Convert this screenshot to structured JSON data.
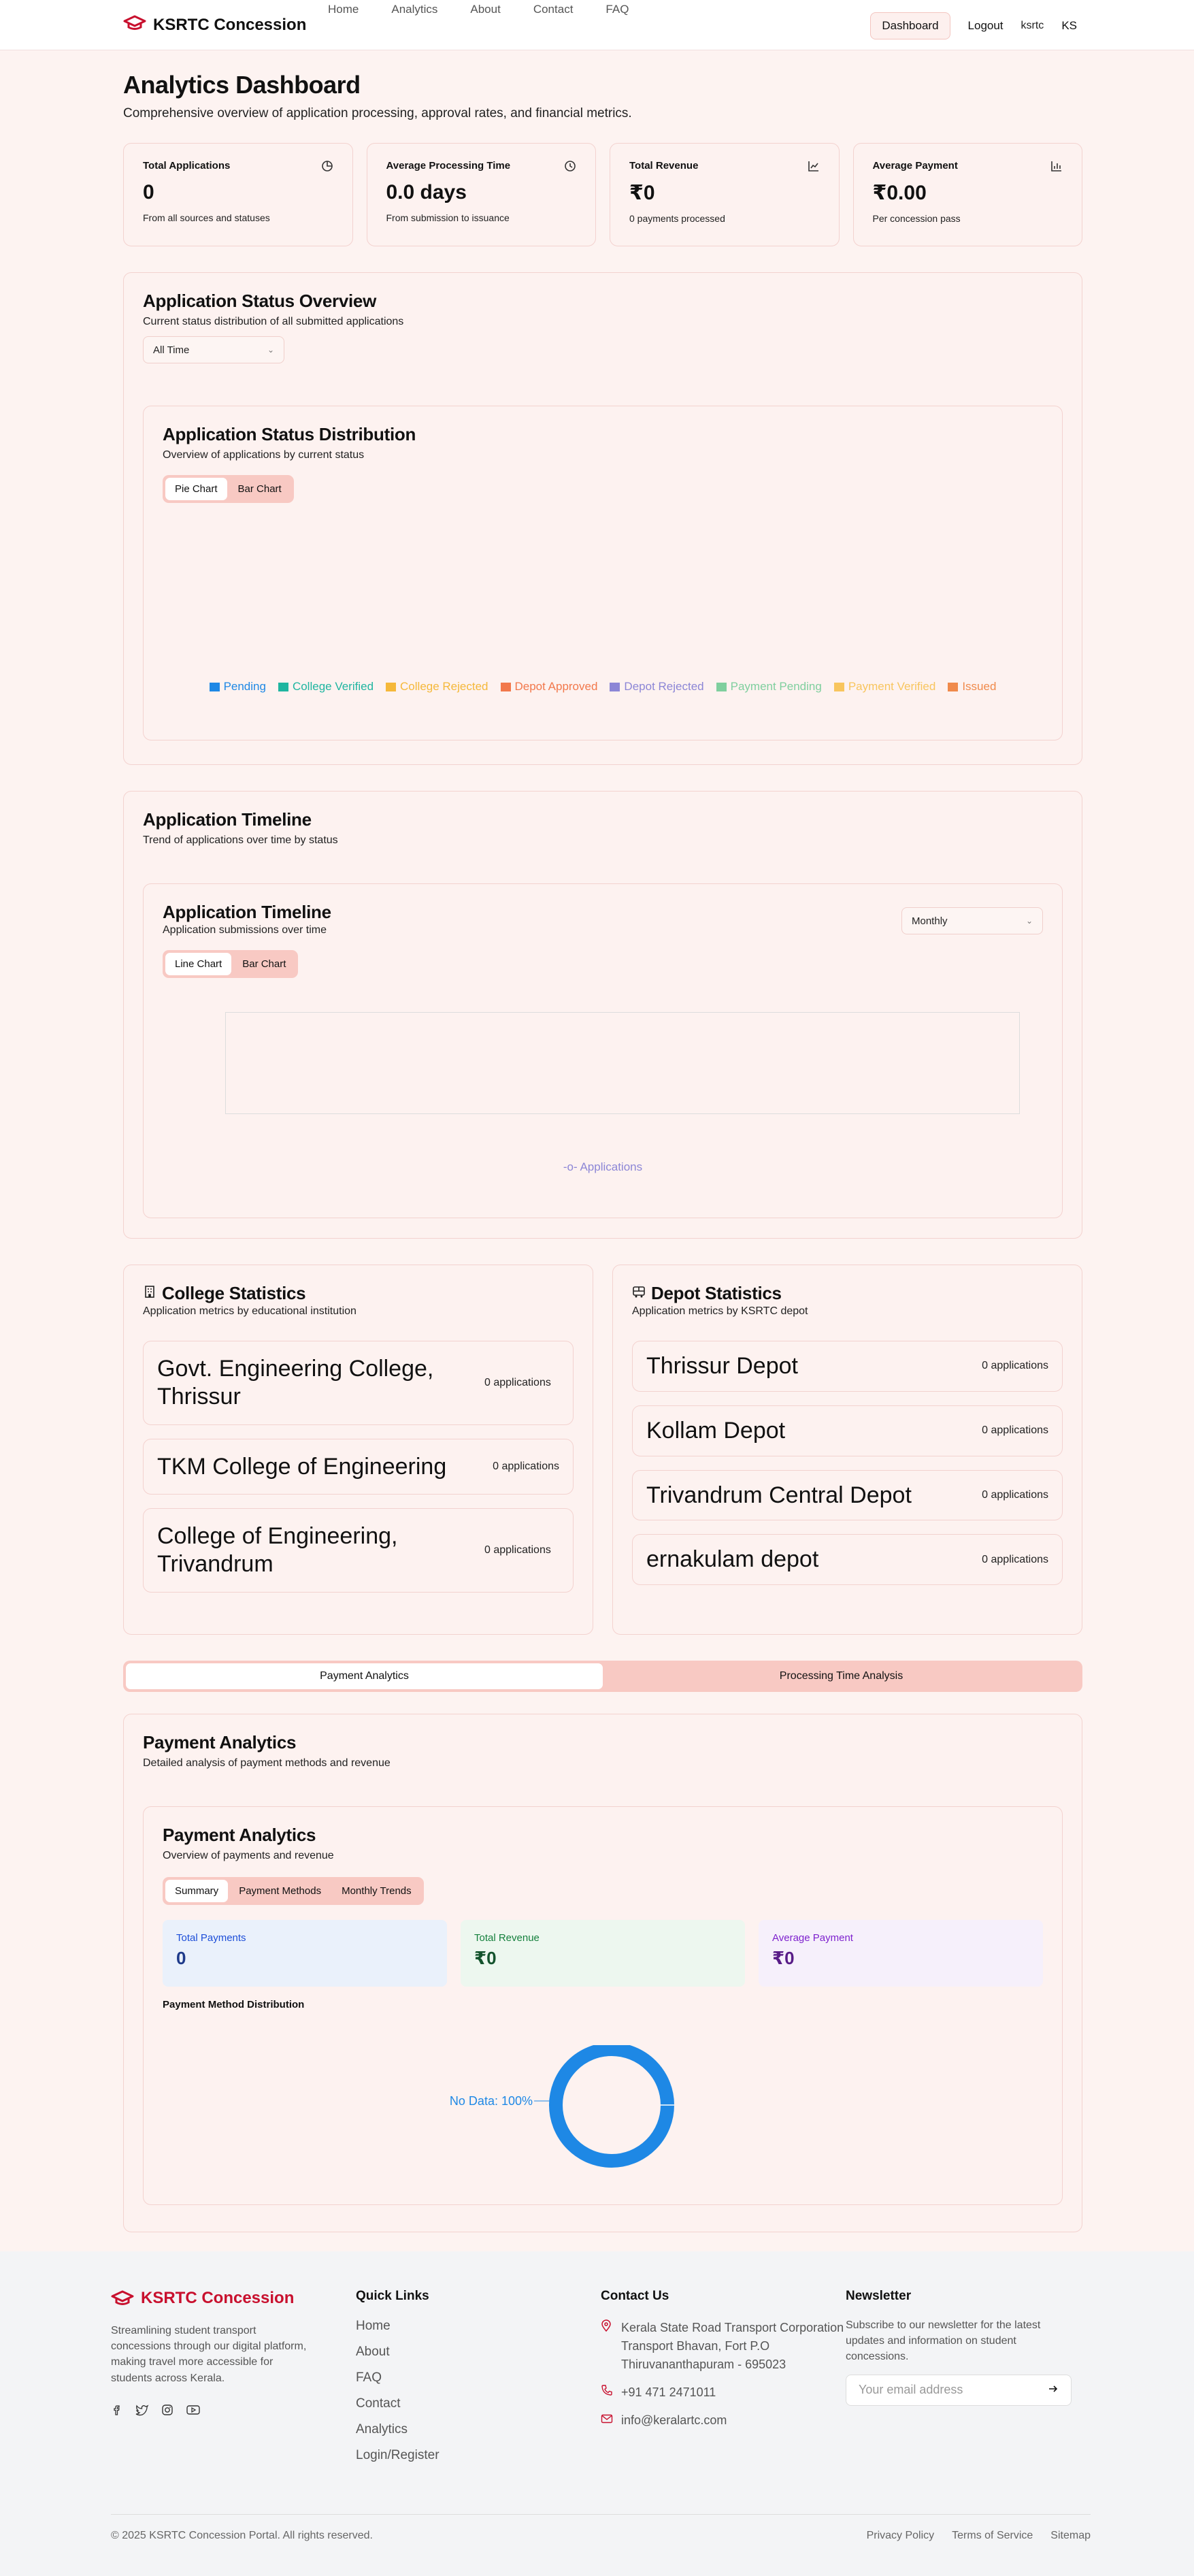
{
  "nav": {
    "brand": "KSRTC Concession",
    "links": [
      "Home",
      "Analytics",
      "About",
      "Contact",
      "FAQ"
    ],
    "dashboard": "Dashboard",
    "logout": "Logout",
    "username": "ksrtc",
    "avatar": "KS"
  },
  "header": {
    "title": "Analytics Dashboard",
    "subtitle": "Comprehensive overview of application processing, approval rates, and financial metrics."
  },
  "stats": [
    {
      "label": "Total Applications",
      "value": "0",
      "desc": "From all sources and statuses",
      "icon": "pie-chart-icon"
    },
    {
      "label": "Average Processing Time",
      "value": "0.0 days",
      "desc": "From submission to issuance",
      "icon": "clock-icon"
    },
    {
      "label": "Total Revenue",
      "value": "₹0",
      "desc": "0 payments processed",
      "icon": "line-chart-icon"
    },
    {
      "label": "Average Payment",
      "value": "₹0.00",
      "desc": "Per concession pass",
      "icon": "bar-chart-icon"
    }
  ],
  "status_overview": {
    "title": "Application Status Overview",
    "subtitle": "Current status distribution of all submitted applications",
    "range": "All Time",
    "chart_title": "Application Status Distribution",
    "chart_subtitle": "Overview of applications by current status",
    "toggle": [
      "Pie Chart",
      "Bar Chart"
    ],
    "legend": [
      {
        "name": "Pending",
        "color": "#1e88e5"
      },
      {
        "name": "College Verified",
        "color": "#1fb5a0"
      },
      {
        "name": "College Rejected",
        "color": "#f5b83a"
      },
      {
        "name": "Depot Approved",
        "color": "#f2784b"
      },
      {
        "name": "Depot Rejected",
        "color": "#8c86d6"
      },
      {
        "name": "Payment Pending",
        "color": "#7fcf9e"
      },
      {
        "name": "Payment Verified",
        "color": "#f8c55e"
      },
      {
        "name": "Issued",
        "color": "#f08a4b"
      }
    ]
  },
  "timeline": {
    "title": "Application Timeline",
    "subtitle": "Trend of applications over time by status",
    "chart_title": "Application Timeline",
    "chart_subtitle": "Application submissions over time",
    "period": "Monthly",
    "toggle": [
      "Line Chart",
      "Bar Chart"
    ],
    "legend": "Applications"
  },
  "college": {
    "title": "College Statistics",
    "subtitle": "Application metrics by educational institution",
    "items": [
      {
        "name": "Govt. Engineering College, Thrissur",
        "count": "0 applications"
      },
      {
        "name": "TKM College of Engineering",
        "count": "0 applications"
      },
      {
        "name": "College of Engineering, Trivandrum",
        "count": "0 applications"
      }
    ]
  },
  "depot": {
    "title": "Depot Statistics",
    "subtitle": "Application metrics by KSRTC depot",
    "items": [
      {
        "name": "Thrissur Depot",
        "count": "0 applications"
      },
      {
        "name": "Kollam Depot",
        "count": "0 applications"
      },
      {
        "name": "Trivandrum Central Depot",
        "count": "0 applications"
      },
      {
        "name": "ernakulam depot",
        "count": "0 applications"
      }
    ]
  },
  "analysis_tabs": [
    "Payment Analytics",
    "Processing Time Analysis"
  ],
  "payment": {
    "title": "Payment Analytics",
    "subtitle": "Detailed analysis of payment methods and revenue",
    "card_title": "Payment Analytics",
    "card_subtitle": "Overview of payments and revenue",
    "toggle": [
      "Summary",
      "Payment Methods",
      "Monthly Trends"
    ],
    "kpis": [
      {
        "label": "Total Payments",
        "value": "0"
      },
      {
        "label": "Total Revenue",
        "value": "₹0"
      },
      {
        "label": "Average Payment",
        "value": "₹0"
      }
    ],
    "dist_title": "Payment Method Distribution",
    "donut_label": "No Data: 100%"
  },
  "chart_data": {
    "type": "pie",
    "title": "Payment Method Distribution",
    "categories": [
      "No Data"
    ],
    "values": [
      100
    ],
    "color": "#1e88e5"
  },
  "footer": {
    "brand": "KSRTC Concession",
    "desc": "Streamlining student transport concessions through our digital platform, making travel more accessible for students across Kerala.",
    "quick_title": "Quick Links",
    "quick": [
      "Home",
      "About",
      "FAQ",
      "Contact",
      "Analytics",
      "Login/Register"
    ],
    "contact_title": "Contact Us",
    "address": [
      "Kerala State Road Transport Corporation",
      "Transport Bhavan, Fort P.O",
      "Thiruvananthapuram - 695023"
    ],
    "phone": "+91 471 2471011",
    "email": "info@keralartc.com",
    "news_title": "Newsletter",
    "news_desc": "Subscribe to our newsletter for the latest updates and information on student concessions.",
    "news_placeholder": "Your email address",
    "copyright": "© 2025 KSRTC Concession Portal. All rights reserved.",
    "legal": [
      "Privacy Policy",
      "Terms of Service",
      "Sitemap"
    ]
  }
}
